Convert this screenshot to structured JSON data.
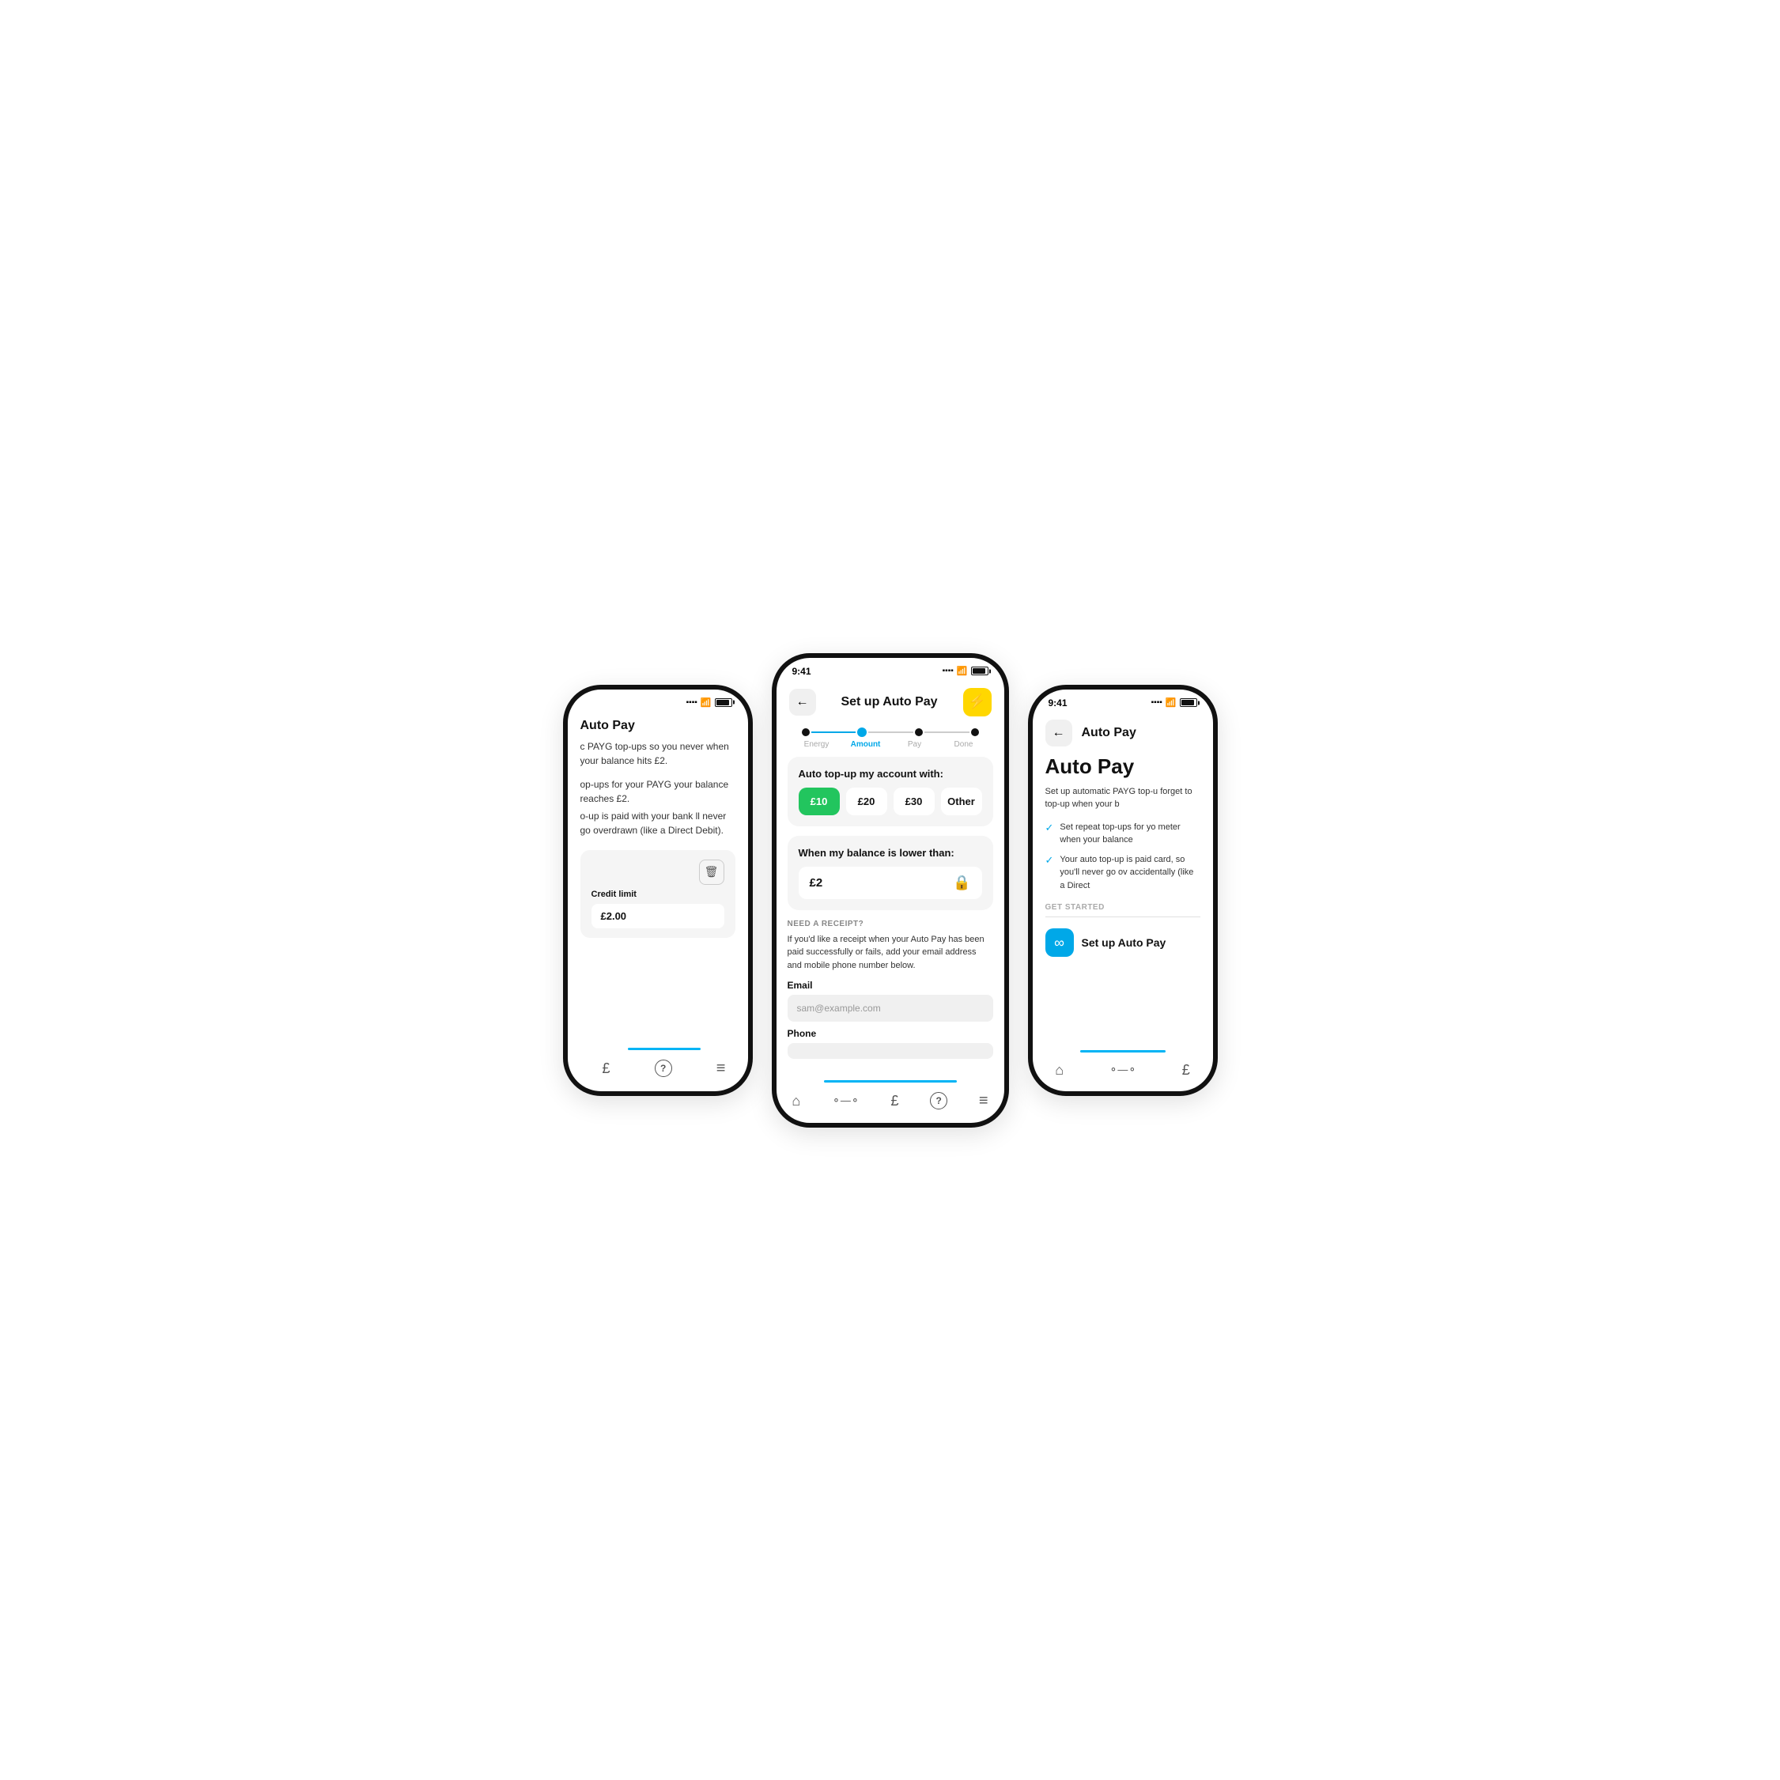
{
  "left_phone": {
    "header_title": "Auto Pay",
    "desc1": "c PAYG top-ups so you never when your balance hits £2.",
    "desc2": "op-ups for your PAYG your balance reaches £2.",
    "desc3": "o-up is paid with your bank ll never go overdrawn (like a Direct Debit).",
    "credit_limit_label": "Credit limit",
    "credit_limit_value": "£2.00",
    "nav_icons": [
      "£",
      "?",
      "≡"
    ]
  },
  "center_phone": {
    "status_time": "9:41",
    "back_label": "←",
    "title": "Set up Auto Pay",
    "lightning": "⚡",
    "steps": [
      "Energy",
      "Amount",
      "Pay",
      "Done"
    ],
    "active_step": 1,
    "amount_section_title": "Auto top-up my account with:",
    "amount_options": [
      "£10",
      "£20",
      "£30",
      "Other"
    ],
    "selected_amount_index": 0,
    "balance_section_title": "When my balance is lower than:",
    "balance_value": "£2",
    "receipt_label": "NEED A RECEIPT?",
    "receipt_desc": "If you'd like a receipt when your Auto Pay has been paid successfully or fails, add your email address and mobile phone number below.",
    "email_label": "Email",
    "email_placeholder": "sam@example.com",
    "phone_label": "Phone",
    "nav_icons": [
      "⌂",
      "⦿",
      "£",
      "?",
      "≡"
    ]
  },
  "right_phone": {
    "status_time": "9:41",
    "back_label": "←",
    "header_title": "Auto Pay",
    "main_heading": "Auto Pay",
    "main_desc": "Set up automatic PAYG top-u forget to top-up when your b",
    "check_items": [
      "Set repeat top-ups for yo meter when your balance",
      "Your auto top-up is paid card, so you'll never go ov accidentally (like a Direct"
    ],
    "get_started_label": "GET STARTED",
    "setup_btn_label": "Set up Auto Pay",
    "nav_icons": [
      "⌂",
      "⦿",
      "£"
    ]
  },
  "colors": {
    "blue": "#00a8e8",
    "green": "#22c55e",
    "yellow": "#ffd700",
    "light_bg": "#f5f5f5",
    "white": "#ffffff",
    "dark": "#111111",
    "gray": "#555555",
    "light_gray": "#aaaaaa",
    "bottom_bar": "#00b4f5"
  }
}
